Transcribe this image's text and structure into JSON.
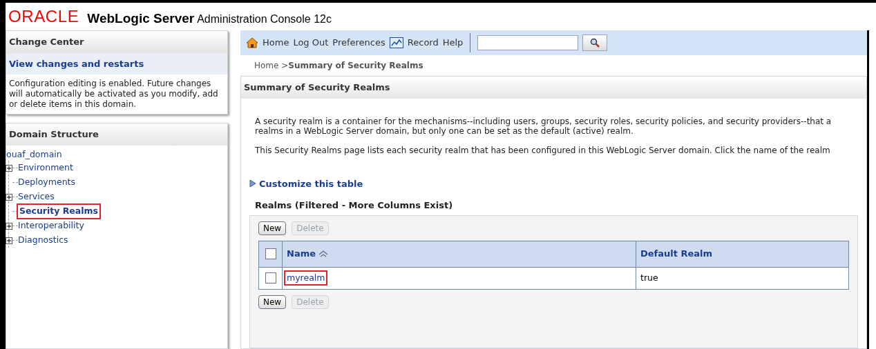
{
  "header": {
    "logo": "ORACLE",
    "product": "WebLogic Server",
    "subtitle": "Administration Console 12c"
  },
  "change_center": {
    "title": "Change Center",
    "link": "View changes and restarts",
    "message": "Configuration editing is enabled. Future changes will automatically be activated as you modify, add or delete items in this domain."
  },
  "domain_structure": {
    "title": "Domain Structure",
    "root": "ouaf_domain",
    "children": [
      {
        "label": "Environment",
        "expandable": true,
        "selected": false
      },
      {
        "label": "Deployments",
        "expandable": false,
        "selected": false
      },
      {
        "label": "Services",
        "expandable": true,
        "selected": false
      },
      {
        "label": "Security Realms",
        "expandable": false,
        "selected": true
      },
      {
        "label": "Interoperability",
        "expandable": true,
        "selected": false
      },
      {
        "label": "Diagnostics",
        "expandable": true,
        "selected": false
      }
    ]
  },
  "toolbar": {
    "links": [
      {
        "label": "Home",
        "kind": "home"
      },
      {
        "label": "Log Out",
        "kind": "plain"
      },
      {
        "label": "Preferences",
        "kind": "plain"
      },
      {
        "label": "Record",
        "kind": "record"
      },
      {
        "label": "Help",
        "kind": "plain"
      }
    ]
  },
  "breadcrumb": {
    "home": "Home >",
    "current": "Summary of Security Realms"
  },
  "page": {
    "title": "Summary of Security Realms",
    "paragraphs": [
      "A security realm is a container for the mechanisms--including users, groups, security roles, security policies, and security providers--that a\nrealms in a WebLogic Server domain, but only one can be set as the default (active) realm.",
      "This Security Realms page lists each security realm that has been configured in this WebLogic Server domain. Click the name of the realm"
    ],
    "customize": "Customize this table"
  },
  "table": {
    "title": "Realms (Filtered - More Columns Exist)",
    "buttons_top": [
      {
        "label": "New",
        "disabled": false
      },
      {
        "label": "Delete",
        "disabled": true
      }
    ],
    "select_all_checked": false,
    "columns": [
      "Name",
      "Default Realm"
    ],
    "rows": [
      {
        "checked": false,
        "name": "myrealm",
        "default_realm": "true",
        "highlighted": true
      }
    ],
    "buttons_bottom": [
      {
        "label": "New",
        "disabled": false
      },
      {
        "label": "Delete",
        "disabled": true
      }
    ]
  }
}
